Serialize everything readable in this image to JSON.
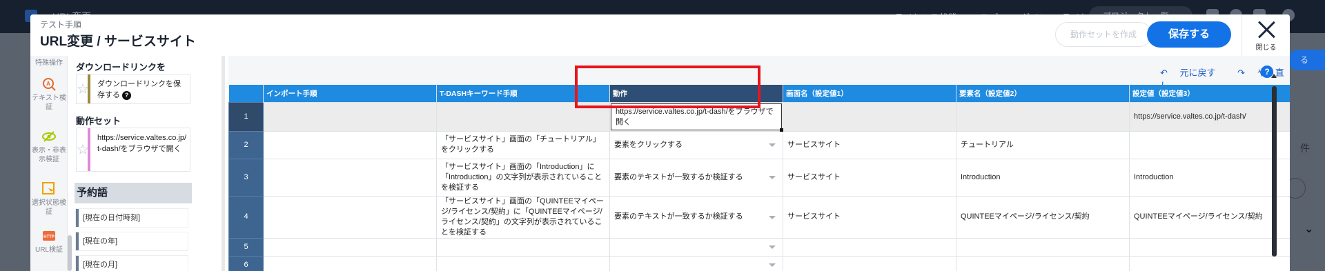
{
  "background": {
    "title": "URL変更",
    "header_right": "ライセンス状態 ・ ヘルプ ・ ログイン ・ ライセンス",
    "pill": "プロジェクト一覧",
    "side_button": "る",
    "count_unit": "件"
  },
  "modal": {
    "subtitle": "テスト手順",
    "title": "URL変更 / サービスサイト",
    "create_set_label": "動作セットを作成",
    "save_label": "保存する",
    "close_label": "閉じる"
  },
  "icon_column": {
    "items": [
      {
        "label": "特殊操作",
        "icon": "special-op-icon"
      },
      {
        "label": "テキスト検証",
        "icon": "text-verify-icon"
      },
      {
        "label": "表示・非表示検証",
        "icon": "visibility-verify-icon"
      },
      {
        "label": "選択状態検証",
        "icon": "selection-verify-icon"
      },
      {
        "label": "URL検証",
        "icon": "http-icon"
      }
    ]
  },
  "palette": {
    "download_header": "ダウンロードリンクを",
    "download_card": "ダウンロードリンクを保存する",
    "action_set_header": "動作セット",
    "action_set_card": "https://service.valtes.co.jp/t-dash/をブラウザで開く",
    "reserved_header": "予約語",
    "reserved_items": [
      "[現在の日付時刻]",
      "[現在の年]",
      "[現在の月]"
    ]
  },
  "toolbar": {
    "undo_label": "元に戻す",
    "redo_label": "やり直し",
    "help_label": "?"
  },
  "table": {
    "columns": [
      "",
      "インポート手順",
      "T-DASHキーワード手順",
      "動作",
      "画面名（設定値1）",
      "要素名（設定値2）",
      "設定値（設定値3）"
    ],
    "rows": [
      {
        "num": "1",
        "import": "",
        "keyword": "",
        "action": "https://service.valtes.co.jp/t-dash/をブラウザで開く",
        "screen": "",
        "element": "",
        "value": "https://service.valtes.co.jp/t-dash/"
      },
      {
        "num": "2",
        "import": "",
        "keyword": "「サービスサイト」画面の「チュートリアル」をクリックする",
        "action": "要素をクリックする",
        "screen": "サービスサイト",
        "element": "チュートリアル",
        "value": ""
      },
      {
        "num": "3",
        "import": "",
        "keyword": "「サービスサイト」画面の「Introduction」に「Introduction」の文字列が表示されていることを検証する",
        "action": "要素のテキストが一致するか検証する",
        "screen": "サービスサイト",
        "element": "Introduction",
        "value": "Introduction"
      },
      {
        "num": "4",
        "import": "",
        "keyword": "「サービスサイト」画面の「QUINTEEマイページ/ライセンス/契約」に「QUINTEEマイページ/ライセンス/契約」の文字列が表示されていることを検証する",
        "action": "要素のテキストが一致するか検証する",
        "screen": "サービスサイト",
        "element": "QUINTEEマイページ/ライセンス/契約",
        "value": "QUINTEEマイページ/ライセンス/契約"
      },
      {
        "num": "5",
        "import": "",
        "keyword": "",
        "action": "",
        "screen": "",
        "element": "",
        "value": ""
      },
      {
        "num": "6",
        "import": "",
        "keyword": "",
        "action": "",
        "screen": "",
        "element": "",
        "value": ""
      }
    ]
  },
  "colors": {
    "accent": "#1373e6",
    "header_blue": "#1f8be0",
    "highlight_red": "#e8141c"
  }
}
